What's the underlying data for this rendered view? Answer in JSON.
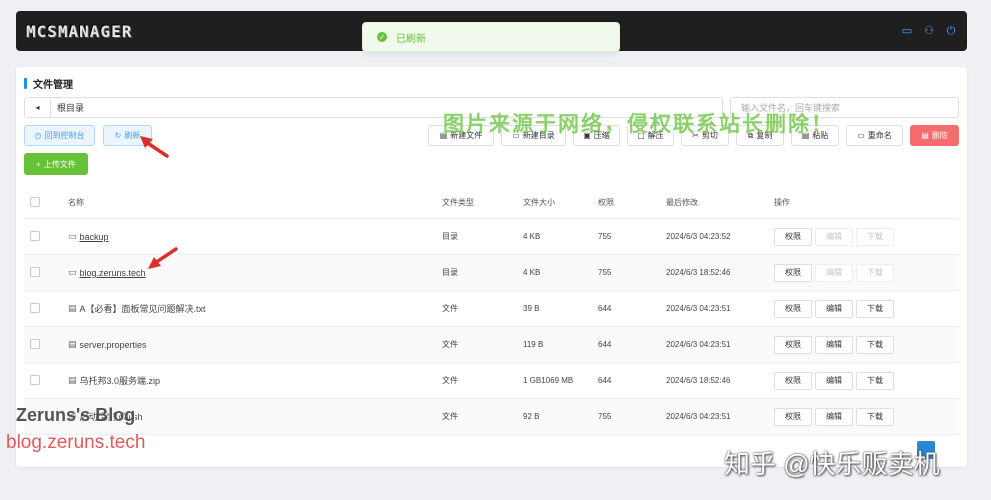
{
  "app": {
    "logo": "MCSMANAGER"
  },
  "header": {
    "icons": [
      "screen-icon",
      "user-icon",
      "power-icon"
    ]
  },
  "toast": {
    "message": "已刷新",
    "icon": "check-circle-icon"
  },
  "panel": {
    "title": "文件管理"
  },
  "path": {
    "back": "◂",
    "current": "根目录"
  },
  "search": {
    "placeholder": "输入文件名，回车键搜索"
  },
  "toolbar": {
    "console": "回到控制台",
    "refresh": "刷新",
    "upload": "上传文件",
    "new_file": "新建文件",
    "new_dir": "新建目录",
    "compress": "压缩",
    "extract": "解压",
    "cut": "剪切",
    "copy": "复制",
    "paste": "粘贴",
    "rename": "重命名",
    "delete": "删除"
  },
  "watermarks": {
    "green": "图片来源于网络，侵权联系站长删除！",
    "blog_name": "Zeruns's Blog",
    "blog_url": "blog.zeruns.tech",
    "zhihu": "知乎 @快乐贩卖机"
  },
  "table": {
    "headers": {
      "name": "名称",
      "type": "文件类型",
      "size": "文件大小",
      "perm": "权限",
      "time": "最后修改",
      "ops": "操作"
    },
    "op_labels": {
      "perm": "权限",
      "edit": "编辑",
      "download": "下载"
    },
    "rows": [
      {
        "name": "backup",
        "type": "目录",
        "size": "4 KB",
        "perm": "755",
        "time": "2024/6/3 04:23:52",
        "is_dir": true
      },
      {
        "name": "blog.zeruns.tech",
        "type": "目录",
        "size": "4 KB",
        "perm": "755",
        "time": "2024/6/3 18:52:46",
        "is_dir": true
      },
      {
        "name": "A【必看】面板常见问题解决.txt",
        "type": "文件",
        "size": "39 B",
        "perm": "644",
        "time": "2024/6/3 04:23:51",
        "is_dir": false
      },
      {
        "name": "server.properties",
        "type": "文件",
        "size": "119 B",
        "perm": "644",
        "time": "2024/6/3 04:23:51",
        "is_dir": false
      },
      {
        "name": "乌托邦3.0服务端.zip",
        "type": "文件",
        "size": "1 GB1069 MB",
        "perm": "644",
        "time": "2024/6/3 18:52:46",
        "is_dir": false
      },
      {
        "name": "启动(需修改).sh",
        "type": "文件",
        "size": "92 B",
        "perm": "755",
        "time": "2024/6/3 04:23:51",
        "is_dir": false
      }
    ]
  },
  "colors": {
    "accent": "#409eff",
    "success": "#67c23a",
    "danger": "#f56c6c",
    "topbar": "#1f1f1f",
    "arrow": "#d9302b"
  }
}
